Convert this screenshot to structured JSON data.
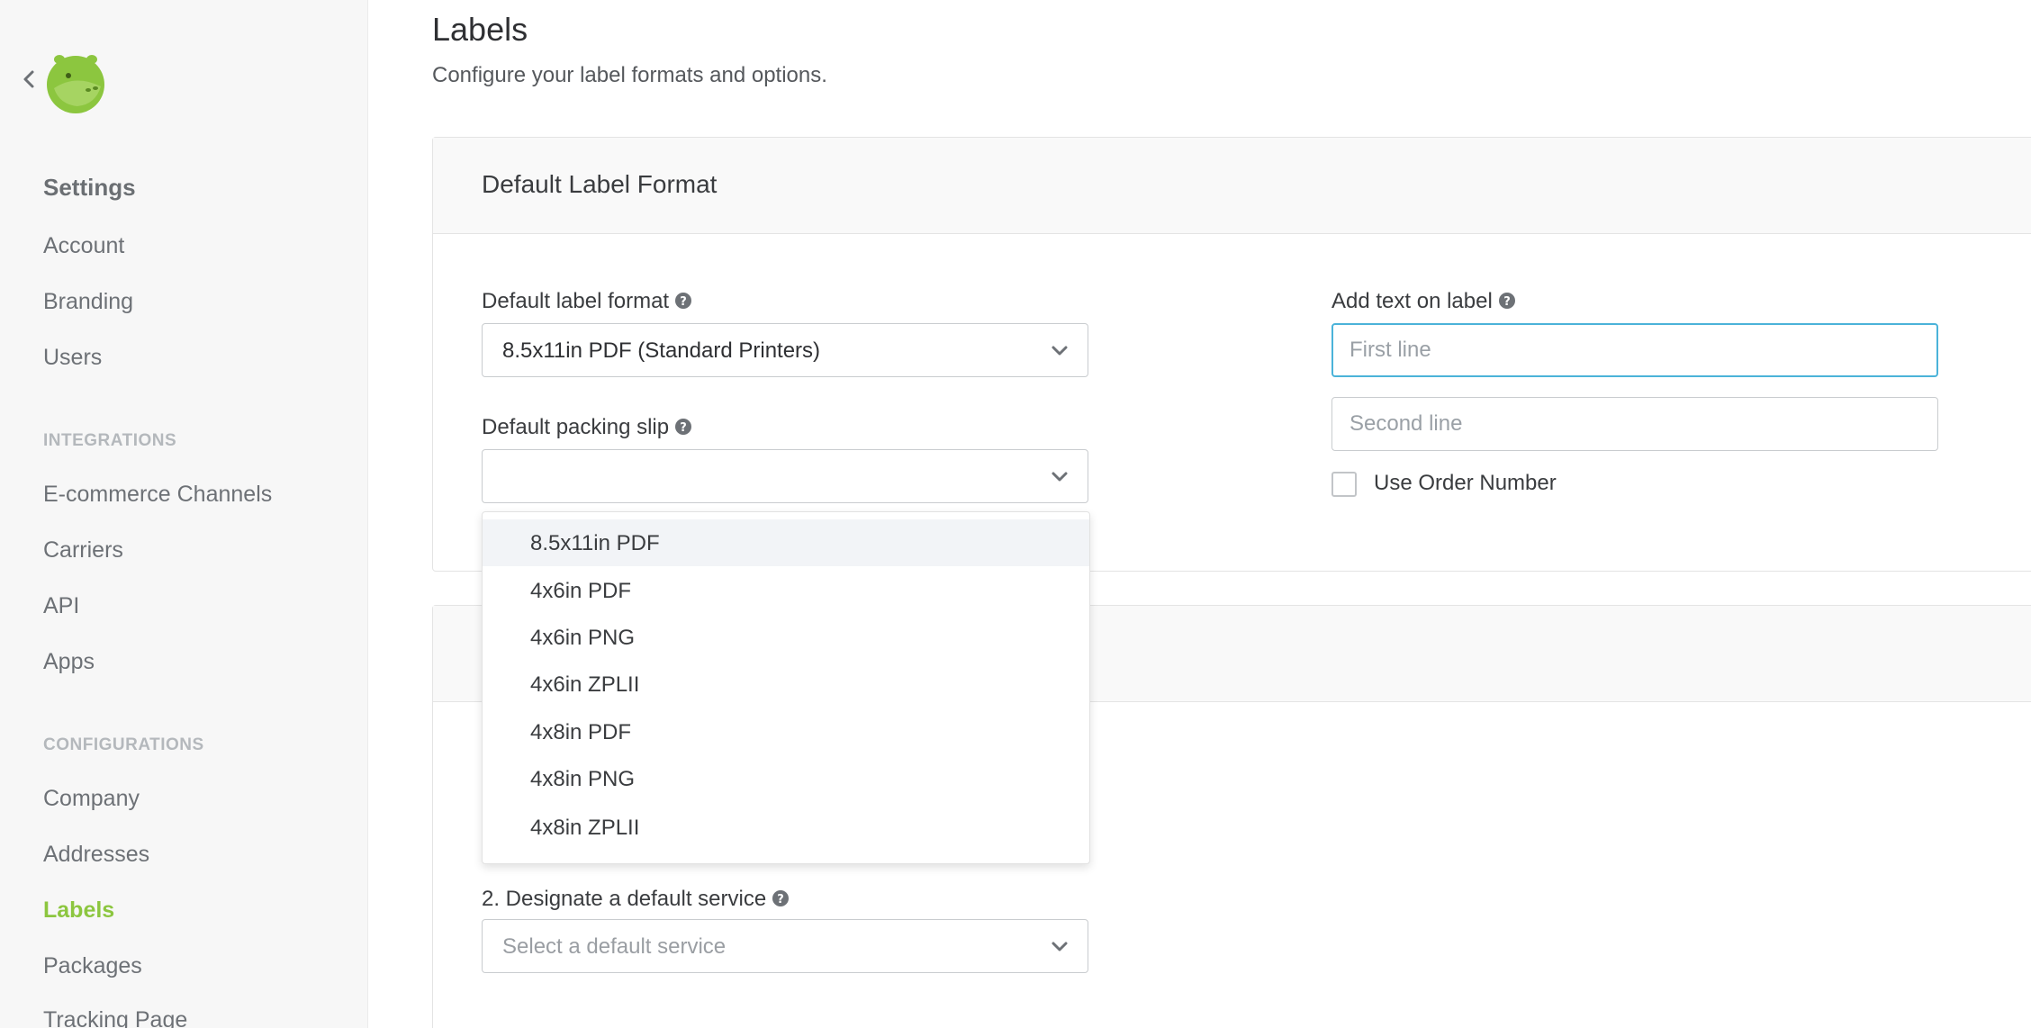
{
  "colors": {
    "accent": "#8cc63f",
    "focus_border": "#4bb3d9",
    "sidebar_bg": "#f7f7f7"
  },
  "icons": {
    "back": "chevron-left-icon",
    "logo": "hippo-logo-icon",
    "help": "question-circle-icon",
    "dropdown": "chevron-down-icon"
  },
  "sidebar": {
    "heading": "Settings",
    "settings_items": [
      {
        "label": "Account"
      },
      {
        "label": "Branding"
      },
      {
        "label": "Users"
      }
    ],
    "integrations_heading": "INTEGRATIONS",
    "integrations_items": [
      {
        "label": "E-commerce Channels"
      },
      {
        "label": "Carriers"
      },
      {
        "label": "API"
      },
      {
        "label": "Apps"
      }
    ],
    "configurations_heading": "CONFIGURATIONS",
    "configurations_items": [
      {
        "label": "Company"
      },
      {
        "label": "Addresses"
      },
      {
        "label": "Labels",
        "active": true
      },
      {
        "label": "Packages"
      },
      {
        "label": "Tracking Page"
      }
    ]
  },
  "page": {
    "title": "Labels",
    "subtitle": "Configure your label formats and options."
  },
  "default_label_card": {
    "title": "Default Label Format",
    "label_format": {
      "label": "Default label format",
      "value": "8.5x11in PDF (Standard Printers)"
    },
    "packing_slip": {
      "label": "Default packing slip",
      "value": "",
      "options": [
        "8.5x11in PDF",
        "4x6in PDF",
        "4x6in PNG",
        "4x6in ZPLII",
        "4x8in PDF",
        "4x8in PNG",
        "4x8in ZPLII"
      ],
      "highlighted_option": "8.5x11in PDF"
    },
    "add_text": {
      "label": "Add text on label",
      "first_line_placeholder": "First line",
      "second_line_placeholder": "Second line",
      "use_order_number_label": "Use Order Number",
      "use_order_number_checked": false
    }
  },
  "second_card": {
    "service": {
      "label": "2. Designate a default service",
      "placeholder": "Select a default service"
    }
  }
}
